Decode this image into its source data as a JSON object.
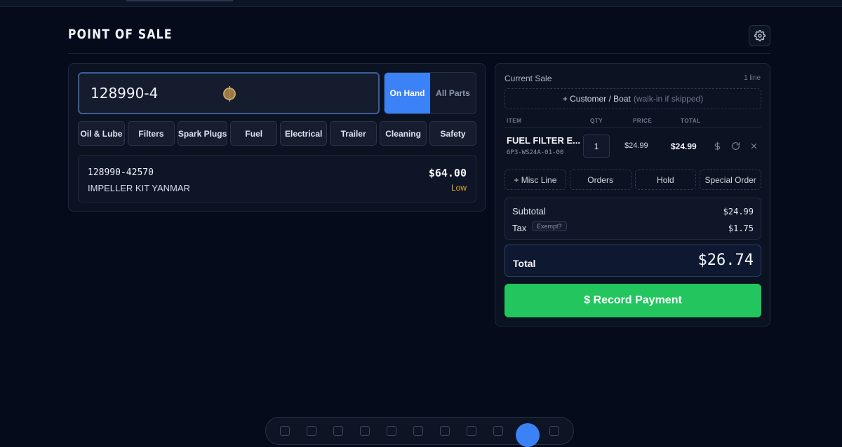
{
  "header": {
    "title": "POINT OF SALE",
    "settings_icon": "gear-icon"
  },
  "search": {
    "value": "128990-4",
    "placeholder": ""
  },
  "stock_toggle": {
    "options": [
      "On Hand",
      "All Parts"
    ],
    "active": "On Hand",
    "active_color": "#3b82f6"
  },
  "categories": [
    "Oil & Lube",
    "Filters",
    "Spark Plugs",
    "Fuel",
    "Electrical",
    "Trailer",
    "Cleaning",
    "Safety"
  ],
  "results": [
    {
      "sku": "128990-42570",
      "name": "IMPELLER KIT YANMAR",
      "price": "$64.00",
      "stock": "Low",
      "stock_color": "#e9a82b"
    }
  ],
  "sale": {
    "title": "Current Sale",
    "line_count": "1 line",
    "customer_button": "+ Customer / Boat",
    "customer_hint": "(walk-in if skipped)",
    "columns": {
      "item": "ITEM",
      "qty": "QTY",
      "price": "PRICE",
      "total": "TOTAL"
    },
    "lines": [
      {
        "name": "FUEL FILTER E...",
        "sku": "6P3-WS24A-01-00",
        "qty": "1",
        "price": "$24.99",
        "total": "$24.99"
      }
    ],
    "actions": [
      "+ Misc Line",
      "Orders",
      "Hold",
      "Special Order"
    ],
    "subtotal_label": "Subtotal",
    "subtotal": "$24.99",
    "tax_label": "Tax",
    "tax_exempt": "Exempt?",
    "tax": "$1.75",
    "total_label": "Total",
    "total": "$26.74",
    "pay_button": "$ Record Payment",
    "pay_color": "#22c55e"
  }
}
